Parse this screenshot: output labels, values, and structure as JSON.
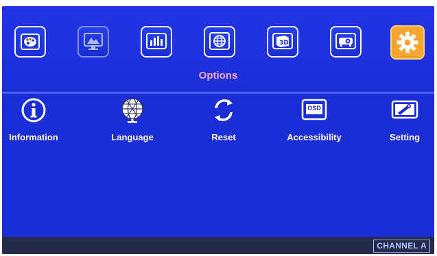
{
  "menu": {
    "icons": [
      {
        "name": "color-palette-icon"
      },
      {
        "name": "display-icon"
      },
      {
        "name": "equalizer-icon"
      },
      {
        "name": "globe-icon"
      },
      {
        "name": "3d-icon"
      },
      {
        "name": "projector-icon"
      },
      {
        "name": "gear-icon",
        "selected": true
      }
    ],
    "selected_label": "Options"
  },
  "options": {
    "items": [
      {
        "label": "Information",
        "icon": "info-icon"
      },
      {
        "label": "Language",
        "icon": "globe-icon"
      },
      {
        "label": "Reset",
        "icon": "reset-icon"
      },
      {
        "label": "Accessibility",
        "icon": "osd-icon"
      },
      {
        "label": "Setting",
        "icon": "setting-icon"
      }
    ],
    "osd_badge": "OSD"
  },
  "status": {
    "channel": "CHANNEL A"
  },
  "colors": {
    "background": "#1b2ed6",
    "selected": "#f6a531",
    "title": "#f7a8cf",
    "status_bar": "#262a4a"
  }
}
